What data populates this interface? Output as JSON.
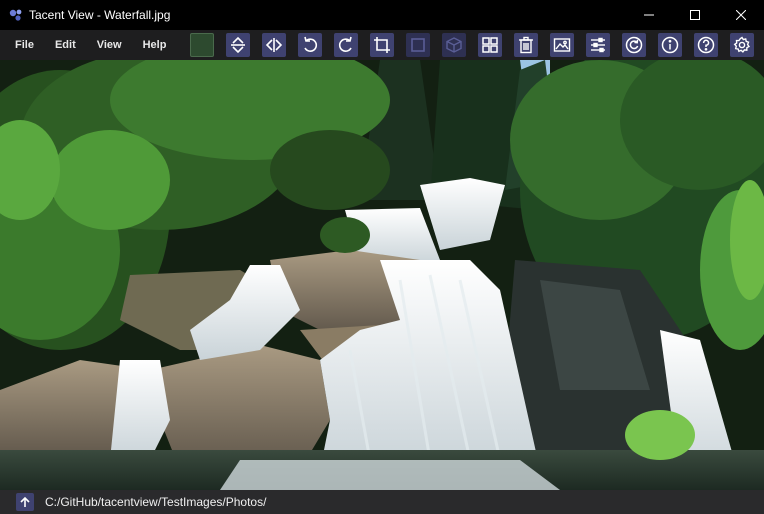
{
  "window": {
    "title": "Tacent View - Waterfall.jpg",
    "app_icon": "tacent-view-logo-icon",
    "controls": [
      "minimize-icon",
      "maximize-icon",
      "close-icon"
    ]
  },
  "menu": {
    "items": [
      "File",
      "Edit",
      "View",
      "Help"
    ]
  },
  "toolbar": {
    "buttons": [
      {
        "name": "background-color-swatch",
        "icon": "color-swatch",
        "color": "#2d4a2f"
      },
      {
        "name": "flip-vertical-button",
        "icon": "flip-vertical-icon"
      },
      {
        "name": "flip-horizontal-button",
        "icon": "flip-horizontal-icon"
      },
      {
        "name": "rotate-ccw-button",
        "icon": "rotate-ccw-icon"
      },
      {
        "name": "rotate-cw-button",
        "icon": "rotate-cw-icon"
      },
      {
        "name": "crop-button",
        "icon": "crop-icon"
      },
      {
        "name": "layer-button",
        "icon": "layer-icon",
        "disabled": true
      },
      {
        "name": "cube-button",
        "icon": "cube-icon",
        "disabled": true
      },
      {
        "name": "thumbnail-view-button",
        "icon": "grid-icon"
      },
      {
        "name": "delete-button",
        "icon": "trash-icon"
      },
      {
        "name": "set-wallpaper-button",
        "icon": "image-icon"
      },
      {
        "name": "adjust-button",
        "icon": "sliders-icon"
      },
      {
        "name": "refresh-button",
        "icon": "refresh-icon"
      },
      {
        "name": "info-button",
        "icon": "info-icon"
      },
      {
        "name": "help-button",
        "icon": "help-icon"
      },
      {
        "name": "preferences-button",
        "icon": "gear-icon"
      }
    ]
  },
  "viewer": {
    "image": "waterfall-photo"
  },
  "status": {
    "up_icon": "arrow-up-icon",
    "path": "C:/GitHub/tacentview/TestImages/Photos/"
  },
  "colors": {
    "titlebar": "#000000",
    "menubar": "#1e1e1f",
    "button": "#3f4270",
    "statusbar": "#2a2a2c"
  }
}
